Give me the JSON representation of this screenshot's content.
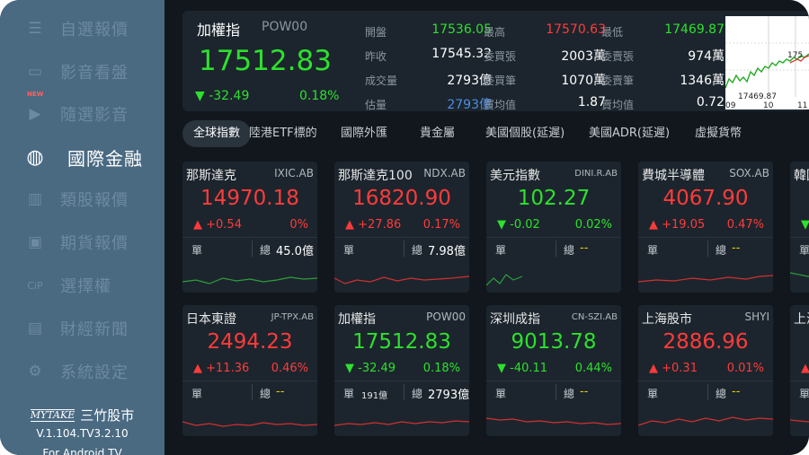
{
  "sidebar": {
    "items": [
      {
        "label": "自選報價",
        "icon": "list-icon",
        "active": false
      },
      {
        "label": "影音看盤",
        "icon": "tv-icon",
        "active": false
      },
      {
        "label": "隨選影音",
        "icon": "video-icon",
        "active": false,
        "badge": "NEW"
      },
      {
        "label": "國際金融",
        "icon": "globe-icon",
        "active": true
      },
      {
        "label": "類股報價",
        "icon": "bar-chart-icon",
        "active": false
      },
      {
        "label": "期貨報價",
        "icon": "futures-icon",
        "active": false
      },
      {
        "label": "選擇權",
        "icon": "option-icon",
        "active": false
      },
      {
        "label": "財經新聞",
        "icon": "news-icon",
        "active": false
      },
      {
        "label": "系統設定",
        "icon": "settings-icon",
        "active": false
      }
    ],
    "brand": {
      "logo_text": "MYTAKE",
      "name": "三竹股市",
      "version": "V.1.104.TV3.2.10",
      "platform": "For Android TV"
    }
  },
  "summary": {
    "name": "加權指",
    "code": "POW00",
    "price": "17512.83",
    "change": "-32.49",
    "change_pct": "0.18%",
    "stats": [
      {
        "label": "開盤",
        "value": "17536.05",
        "color": "green"
      },
      {
        "label": "昨收",
        "value": "17545.32",
        "color": "white"
      },
      {
        "label": "成交量",
        "value": "2793億",
        "color": "white"
      },
      {
        "label": "估量",
        "value": "2793億",
        "color": "blue"
      },
      {
        "label": "最高",
        "value": "17570.63",
        "color": "red"
      },
      {
        "label": "委買張",
        "value": "2003萬",
        "color": "white"
      },
      {
        "label": "委買筆",
        "value": "1070萬",
        "color": "white"
      },
      {
        "label": "買均值",
        "value": "1.87",
        "color": "white"
      },
      {
        "label": "最低",
        "value": "17469.87",
        "color": "green"
      },
      {
        "label": "委賣張",
        "value": "974萬",
        "color": "white"
      },
      {
        "label": "委賣筆",
        "value": "1346萬",
        "color": "white"
      },
      {
        "label": "賣均值",
        "value": "0.72",
        "color": "white"
      }
    ],
    "mini_chart": {
      "high_label": "175",
      "low_label": "17469.87",
      "x_ticks": [
        "09",
        "10",
        "11"
      ]
    }
  },
  "tabs": [
    {
      "label": "全球指數",
      "active": true
    },
    {
      "label": "陸港ETF標的",
      "active": false
    },
    {
      "label": "國際外匯",
      "active": false
    },
    {
      "label": "貴金屬",
      "active": false
    },
    {
      "label": "美國個股(延遲)",
      "active": false
    },
    {
      "label": "美國ADR(延遲)",
      "active": false
    },
    {
      "label": "虛擬貨幣",
      "active": false
    }
  ],
  "cards": [
    {
      "name": "那斯達克",
      "code": "IXIC.AB",
      "price": "14970.18",
      "dir": "up",
      "change": "+0.54",
      "pct": "0%",
      "label1": "單",
      "value1": "",
      "label2": "總",
      "value2": "45.0億",
      "line_color": "#2e9e3a"
    },
    {
      "name": "那斯達克100",
      "code": "NDX.AB",
      "price": "16820.90",
      "dir": "up",
      "change": "+27.86",
      "pct": "0.17%",
      "label1": "單",
      "value1": "",
      "label2": "總",
      "value2": "7.98億",
      "line_color": "#d03030"
    },
    {
      "name": "美元指數",
      "code": "DINI.R.AB",
      "price": "102.27",
      "dir": "down",
      "change": "-0.02",
      "pct": "0.02%",
      "label1": "單",
      "value1": "",
      "label2": "總",
      "value2": "--",
      "line_color": "#2e9e3a"
    },
    {
      "name": "費城半導體",
      "code": "SOX.AB",
      "price": "4067.90",
      "dir": "up",
      "change": "+19.05",
      "pct": "0.47%",
      "label1": "單",
      "value1": "",
      "label2": "總",
      "value2": "--",
      "line_color": "#d03030"
    },
    {
      "name": "韓國",
      "code": "",
      "price": "",
      "dir": "down",
      "change": "",
      "pct": "",
      "label1": "單",
      "value1": "",
      "label2": "",
      "value2": "",
      "line_color": "#2e9e3a"
    },
    {
      "name": "日本東證",
      "code": "JP-TPX.AB",
      "price": "2494.23",
      "dir": "up",
      "change": "+11.36",
      "pct": "0.46%",
      "label1": "單",
      "value1": "",
      "label2": "總",
      "value2": "--",
      "line_color": "#d03030"
    },
    {
      "name": "加權指",
      "code": "POW00",
      "price": "17512.83",
      "dir": "down",
      "change": "-32.49",
      "pct": "0.18%",
      "label1": "單",
      "value1": "191億",
      "label2": "總",
      "value2": "2793億",
      "line_color": "#d03030"
    },
    {
      "name": "深圳成指",
      "code": "CN-SZI.AB",
      "price": "9013.78",
      "dir": "down",
      "change": "-40.11",
      "pct": "0.44%",
      "label1": "單",
      "value1": "",
      "label2": "總",
      "value2": "--",
      "line_color": "#d03030"
    },
    {
      "name": "上海股市",
      "code": "SHYI",
      "price": "2886.96",
      "dir": "up",
      "change": "+0.31",
      "pct": "0.01%",
      "label1": "單",
      "value1": "",
      "label2": "總",
      "value2": "--",
      "line_color": "#d03030"
    },
    {
      "name": "上海",
      "code": "",
      "price": "",
      "dir": "up",
      "change": "",
      "pct": "",
      "label1": "單",
      "value1": "",
      "label2": "",
      "value2": "",
      "line_color": "#d03030"
    }
  ],
  "colors": {
    "up": "#ff3b3b",
    "down": "#2ee02e",
    "sidebar_bg": "#4a6a82",
    "card_bg": "#1c252d"
  }
}
